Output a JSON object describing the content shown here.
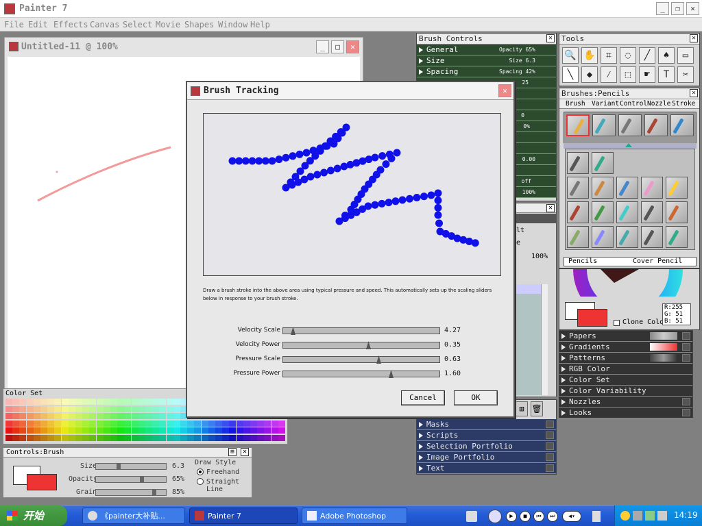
{
  "app": {
    "title": "Painter 7"
  },
  "menu": [
    "File",
    "Edit",
    "Effects",
    "Canvas",
    "Select",
    "Movie",
    "Shapes",
    "Window",
    "Help"
  ],
  "document": {
    "title": "Untitled-11 @ 100%"
  },
  "color_set": {
    "title": "Color Set"
  },
  "controls_brush": {
    "title": "Controls:Brush",
    "size_label": "Size",
    "size_value": "6.3",
    "opacity_label": "Opacity",
    "opacity_value": "65%",
    "grain_label": "Grain",
    "grain_value": "85%",
    "draw_style_label": "Draw Style",
    "freehand": "Freehand",
    "straight_line": "Straight Line"
  },
  "brush_controls": {
    "title": "Brush Controls",
    "rows": [
      {
        "label": "General",
        "value": "Opacity 65%"
      },
      {
        "label": "Size",
        "value": "Size 6.3"
      },
      {
        "label": "Spacing",
        "value": "Spacing 42%"
      }
    ],
    "partial_values": [
      "25",
      "0",
      "0%",
      "0.00",
      "off",
      "100%"
    ]
  },
  "tools": {
    "title": "Tools"
  },
  "brushes": {
    "title": "Brushes:Pencils",
    "tabs": [
      "Brush",
      "Variant",
      "Control",
      "Nozzle",
      "Stroke"
    ],
    "category": "Pencils",
    "variant": "Cover Pencil"
  },
  "mid_panel": {
    "partial_text": [
      "lt",
      "e"
    ],
    "zoom": "100%"
  },
  "color": {
    "readout_r": "R:255",
    "readout_g": "G: 51",
    "readout_b": "B: 51",
    "clone_color": "Clone Color",
    "primary": "#ee3333"
  },
  "right_panels": [
    "Papers",
    "Gradients",
    "Patterns",
    "RGB Color",
    "Color Set",
    "Color Variability",
    "Nozzles",
    "Looks"
  ],
  "lower_panels": [
    "Masks",
    "Scripts",
    "Selection Portfolio",
    "Image Portfolio",
    "Text"
  ],
  "dialog": {
    "title": "Brush Tracking",
    "description": "Draw a brush stroke into the above area using typical pressure and speed. This automatically sets up the scaling sliders below in response to your brush stroke.",
    "sliders": [
      {
        "label": "Velocity Scale",
        "value": "4.27",
        "fraction": 0.05
      },
      {
        "label": "Velocity Power",
        "value": "0.35",
        "fraction": 0.55
      },
      {
        "label": "Pressure Scale",
        "value": "0.63",
        "fraction": 0.62
      },
      {
        "label": "Pressure Power",
        "value": "1.60",
        "fraction": 0.7
      }
    ],
    "cancel": "Cancel",
    "ok": "OK"
  },
  "taskbar": {
    "start": "开始",
    "tasks": [
      "《painter大补贴...",
      "Painter 7",
      "Adobe Photoshop"
    ],
    "clock": "14:19"
  }
}
